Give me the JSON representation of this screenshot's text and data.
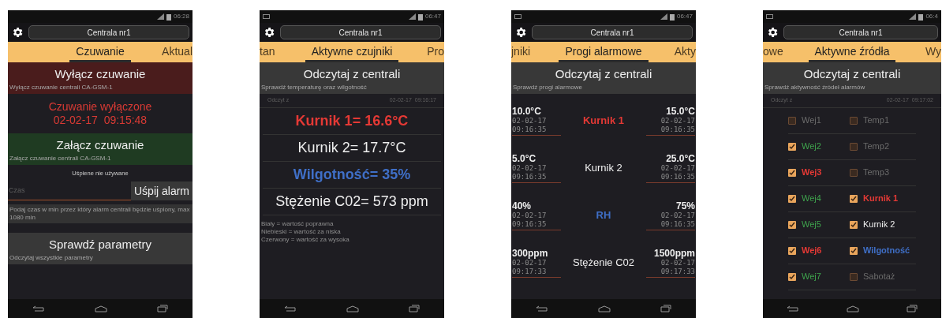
{
  "phones": [
    {
      "status": {
        "time": "06:28",
        "notification": false
      },
      "title": "Centrala nr1",
      "tabs": [
        {
          "label": "Czuwanie",
          "selected": true
        },
        {
          "label": "Aktual",
          "selected": false
        }
      ],
      "blocks": [
        {
          "kind": "action",
          "color": "#4a1c1c",
          "title": "Wyłącz czuwanie",
          "subtitle": "Wyłącz czuwanie centrali CA-GSM-1"
        },
        {
          "kind": "status",
          "lines": [
            "Czuwanie wyłączone",
            "02-02-17  09:15:48"
          ]
        },
        {
          "kind": "action",
          "color": "#1f3b22",
          "title": "Załącz czuwanie",
          "subtitle": "Załącz czuwanie centrali CA-GSM-1"
        },
        {
          "kind": "note",
          "text": "Uśpiene nie używane"
        },
        {
          "kind": "sleep",
          "placeholder": "Czas",
          "button": "Uśpij alarm",
          "hint": "Podaj czas w min przez który alarm centrali będzie uśpiony, max 1080 min"
        },
        {
          "kind": "action",
          "color": "#383838",
          "title": "Sprawdź parametry",
          "subtitle": "Odczytaj wszystkie parametry"
        }
      ]
    },
    {
      "status": {
        "time": "06:47",
        "notification": true
      },
      "title": "Centrala nr1",
      "tabs": [
        {
          "label": "tan",
          "selected": false
        },
        {
          "label": "Aktywne czujniki",
          "selected": true
        },
        {
          "label": "Pro",
          "selected": false
        }
      ],
      "blocks": [
        {
          "kind": "action",
          "color": "#383838",
          "title": "Odczytaj z centrali",
          "subtitle": "Sprawdź temperaturę oraz wilgotność"
        },
        {
          "kind": "read_time",
          "label": "Odczyt z",
          "value": "02-02-17  09:16:17"
        },
        {
          "kind": "readings",
          "items": [
            {
              "text": "Kurnik 1= 16.6°C",
              "color": "#e53935",
              "bold": true
            },
            {
              "text": "Kurnik 2= 17.7°C",
              "color": "#eeeeee",
              "bold": false
            },
            {
              "text": "Wilgotność= 35%",
              "color": "#3f6fc7",
              "bold": true
            },
            {
              "text": "Stężenie C02= 573 ppm",
              "color": "#eeeeee",
              "bold": false
            }
          ]
        },
        {
          "kind": "legend",
          "lines": [
            "Biały = wartość poprawna",
            "Niebieski = wartość za niska",
            "Czerwony = wartość za wysoka"
          ]
        }
      ]
    },
    {
      "status": {
        "time": "06:47",
        "notification": true
      },
      "title": "Centrala nr1",
      "tabs": [
        {
          "label": "jniki",
          "selected": false
        },
        {
          "label": "Progi alarmowe",
          "selected": true
        },
        {
          "label": "Akty",
          "selected": false
        }
      ],
      "blocks": [
        {
          "kind": "action",
          "color": "#383838",
          "title": "Odczytaj z centrali",
          "subtitle": "Sprawdź progi alarmowe"
        },
        {
          "kind": "thresholds",
          "rows": [
            {
              "low": {
                "value": "10.0°C",
                "date": "02-02-17",
                "time": "09:16:35"
              },
              "name": "Kurnik 1",
              "color": "#e53935",
              "bold": true,
              "high": {
                "value": "15.0°C",
                "date": "02-02-17",
                "time": "09:16:35"
              }
            },
            {
              "low": {
                "value": "5.0°C",
                "date": "02-02-17",
                "time": "09:16:35"
              },
              "name": "Kurnik 2",
              "color": "#eeeeee",
              "bold": false,
              "high": {
                "value": "25.0°C",
                "date": "02-02-17",
                "time": "09:16:35"
              }
            },
            {
              "low": {
                "value": "40%",
                "date": "02-02-17",
                "time": "09:16:35"
              },
              "name": "RH",
              "color": "#3f6fc7",
              "bold": true,
              "high": {
                "value": "75%",
                "date": "02-02-17",
                "time": "09:16:35"
              }
            },
            {
              "low": {
                "value": "300ppm",
                "date": "02-02-17",
                "time": "09:17:33"
              },
              "name": "Stężenie C02",
              "color": "#eeeeee",
              "bold": false,
              "high": {
                "value": "1500ppm",
                "date": "02-02-17",
                "time": "09:17:33"
              }
            }
          ]
        }
      ]
    },
    {
      "status": {
        "time": "06:4",
        "notification": true
      },
      "title": "Centrala nr1",
      "tabs": [
        {
          "label": "owe",
          "selected": false
        },
        {
          "label": "Aktywne źródła",
          "selected": true
        },
        {
          "label": "Wy",
          "selected": false
        }
      ],
      "blocks": [
        {
          "kind": "action",
          "color": "#383838",
          "title": "Odczytaj z centrali",
          "subtitle": "Sprawdź aktywność źródeł alarmów"
        },
        {
          "kind": "read_time",
          "label": "Odczyt z",
          "value": "02-02-17  09:17:02"
        },
        {
          "kind": "sources",
          "rows": [
            {
              "left": {
                "label": "Wej1",
                "checked": false,
                "color": "#6b6b6b",
                "bold": false
              },
              "right": {
                "label": "Temp1",
                "checked": false,
                "color": "#6b6b6b",
                "bold": false
              }
            },
            {
              "left": {
                "label": "Wej2",
                "checked": true,
                "color": "#3fa34d",
                "bold": false
              },
              "right": {
                "label": "Temp2",
                "checked": false,
                "color": "#6b6b6b",
                "bold": false
              }
            },
            {
              "left": {
                "label": "Wej3",
                "checked": true,
                "color": "#e53935",
                "bold": true
              },
              "right": {
                "label": "Temp3",
                "checked": false,
                "color": "#6b6b6b",
                "bold": false
              }
            },
            {
              "left": {
                "label": "Wej4",
                "checked": true,
                "color": "#3fa34d",
                "bold": false
              },
              "right": {
                "label": "Kurnik 1",
                "checked": true,
                "color": "#e53935",
                "bold": true
              }
            },
            {
              "left": {
                "label": "Wej5",
                "checked": true,
                "color": "#3fa34d",
                "bold": false
              },
              "right": {
                "label": "Kurnik 2",
                "checked": true,
                "color": "#eeeeee",
                "bold": false
              }
            },
            {
              "left": {
                "label": "Wej6",
                "checked": true,
                "color": "#e53935",
                "bold": true
              },
              "right": {
                "label": "Wilgotność",
                "checked": true,
                "color": "#3f6fc7",
                "bold": true
              }
            },
            {
              "left": {
                "label": "Wej7",
                "checked": true,
                "color": "#3fa34d",
                "bold": false
              },
              "right": {
                "label": "Sabotaż",
                "checked": false,
                "color": "#6b6b6b",
                "bold": false
              }
            }
          ]
        }
      ]
    }
  ]
}
